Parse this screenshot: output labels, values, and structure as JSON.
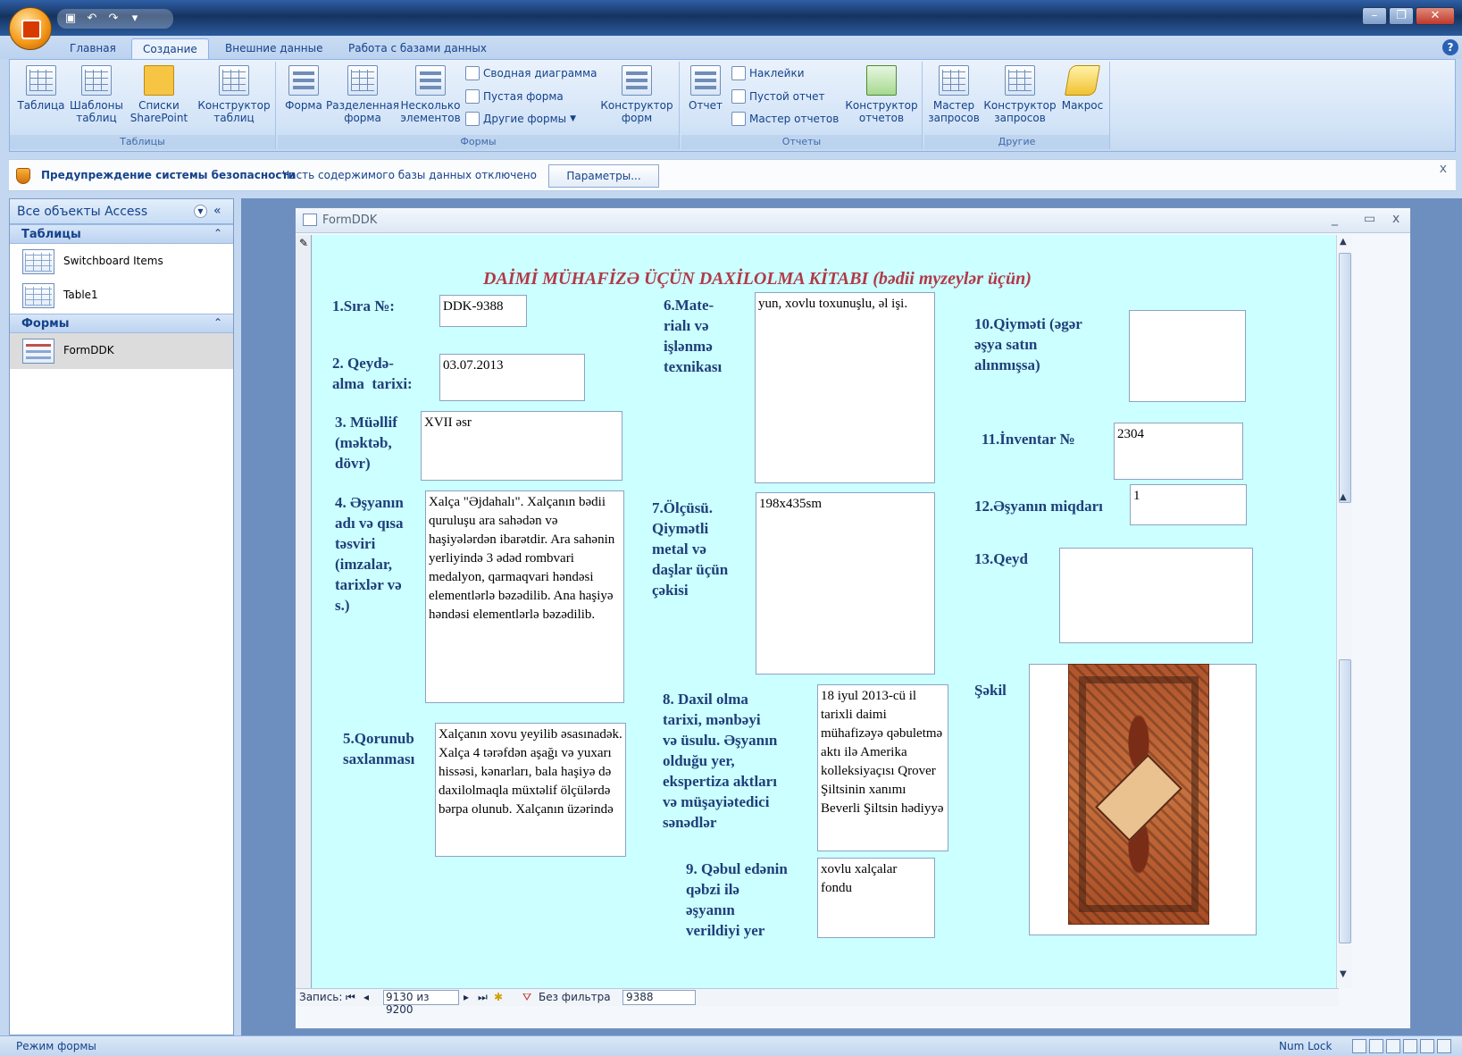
{
  "ribbon_tabs": [
    "Главная",
    "Создание",
    "Внешние данные",
    "Работа с базами данных"
  ],
  "ribbon": {
    "groups": {
      "tables": "Таблицы",
      "forms": "Формы",
      "reports": "Отчеты",
      "other": "Другие"
    },
    "buttons": {
      "table": "Таблица",
      "table_templates": "Шаблоны таблиц",
      "sharepoint_lists": "Списки SharePoint",
      "table_designer": "Конструктор таблиц",
      "form": "Форма",
      "split_form": "Разделенная форма",
      "multiple_items": "Несколько элементов",
      "pivot_chart": "Сводная диаграмма",
      "blank_form": "Пустая форма",
      "other_forms": "Другие формы",
      "form_designer": "Конструктор форм",
      "report": "Отчет",
      "labels": "Наклейки",
      "blank_report": "Пустой отчет",
      "report_wizard": "Мастер отчетов",
      "report_designer": "Конструктор отчетов",
      "query_wizard": "Мастер запросов",
      "query_designer": "Конструктор запросов",
      "macro": "Макрос"
    }
  },
  "security": {
    "title": "Предупреждение системы безопасности",
    "message": "Часть содержимого базы данных отключено",
    "button": "Параметры..."
  },
  "nav": {
    "title": "Все объекты Access",
    "tables_group": "Таблицы",
    "tables": [
      "Switchboard Items",
      "Table1"
    ],
    "forms_group": "Формы",
    "forms": [
      "FormDDK"
    ]
  },
  "form_window": {
    "title": "FormDDK"
  },
  "form": {
    "title": "DAİMİ MÜHAFİZƏ ÜÇÜN DAXİLOLMA KİTABI (bədii myzeylər üçün)",
    "labels": {
      "f1": "1.Sıra №:",
      "f2": "2. Qeydə-\nalma  tarixi:",
      "f3": "3. Müəllif\n(məktəb,\ndövr)",
      "f4": "4. Əşyanın\nadı və qısa\ntəsviri\n(imzalar,\ntarixlər və\ns.)",
      "f5": "5.Qorunub\nsaxlanması",
      "f6": "6.Mate-\nrialı və\nişlənmə\ntexnikası",
      "f7": "7.Ölçüsü.\nQiymətli\nmetal və\ndaşlar üçün\nçəkisi",
      "f8": "8. Daxil olma\ntarixi, mənbəyi\nvə üsulu. Əşyanın\nolduğu yer,\nekspertiza aktları\nvə müşayiətedici\nsənədlər",
      "f9": "9. Qəbul edənin\nqəbzi ilə\nəşyanın\nverildiyi yer",
      "f10": "10.Qiyməti (əgər\nəşya satın\nalınmışsa)",
      "f11": "11.İnventar №",
      "f12": "12.Əşyanın miqdarı",
      "f13": "13.Qeyd",
      "photo": "Şəkil"
    },
    "values": {
      "f1": "DDK-9388",
      "f2": "03.07.2013",
      "f3": "XVII əsr",
      "f4": "Xalça \"Əjdahalı\". Xalçanın bədii quruluşu ara sahədən və haşiyələrdən ibarətdir. Ara sahənin yerliyində 3 ədəd rombvari medalyon, qarmaqvari həndəsi elementlərlə bəzədilib. Ana haşiyə həndəsi elementlərlə bəzədilib.",
      "f5": "Xalçanın xovu yeyilib əsasınadək. Xalça 4 tərəfdən aşağı və yuxarı hissəsi, kənarları, bala haşiyə də daxilolmaqla müxtəlif ölçülərdə  bərpa olunub. Xalçanın üzərində",
      "f6": "yun, xovlu toxunuşlu, əl işi.",
      "f7": "198x435sm",
      "f8": "18 iyul 2013-cü il tarixli daimi mühafizəyə qəbuletmə aktı ilə Amerika kolleksiyaçısı Qrover Şiltsinin xanımı Beverli Şiltsin hədiyyə",
      "f9": "xovlu xalçalar fondu",
      "f10": "",
      "f11": "2304",
      "f12": "1",
      "f13": ""
    }
  },
  "record_nav": {
    "label": "Запись:",
    "current": "9130 из 9200",
    "filter": "Без фильтра",
    "search": "9388"
  },
  "status": {
    "mode": "Режим формы",
    "numlock": "Num Lock"
  }
}
